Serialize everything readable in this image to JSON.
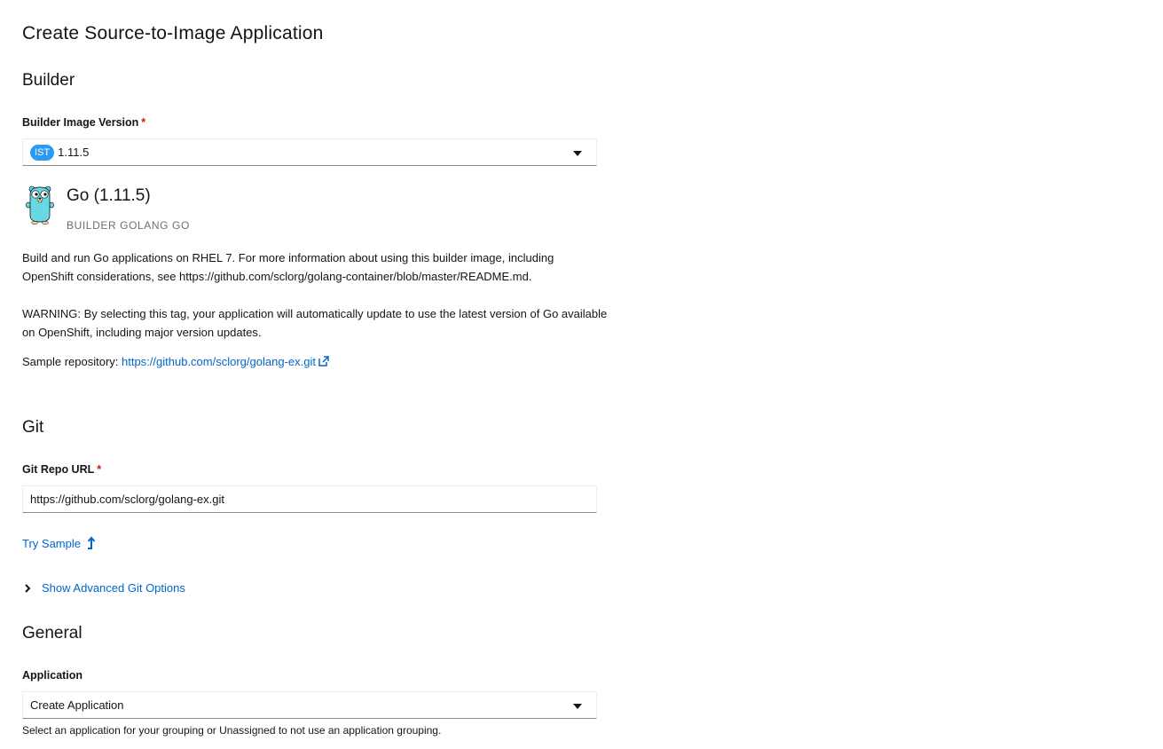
{
  "page": {
    "title": "Create Source-to-Image Application"
  },
  "builder": {
    "section_title": "Builder",
    "image_version_label": "Builder Image Version",
    "required_mark": "*",
    "selected_badge": "IST",
    "selected_version": "1.11.5",
    "name": "Go (1.11.5)",
    "tags": "BUILDER GOLANG GO",
    "description": "Build and run Go applications on RHEL 7. For more information about using this builder image, including OpenShift considerations, see https://github.com/sclorg/golang-container/blob/master/README.md.",
    "warning": "WARNING: By selecting this tag, your application will automatically update to use the latest version of Go available on OpenShift, including major version updates.",
    "sample_repo_label": "Sample repository: ",
    "sample_repo_url": "https://github.com/sclorg/golang-ex.git",
    "icon": "gopher-icon"
  },
  "git": {
    "section_title": "Git",
    "repo_url_label": "Git Repo URL",
    "required_mark": "*",
    "repo_url_value": "https://github.com/sclorg/golang-ex.git",
    "try_sample_label": "Try Sample",
    "advanced_options_label": "Show Advanced Git Options"
  },
  "general": {
    "section_title": "General",
    "application_label": "Application",
    "application_value": "Create Application",
    "application_helper": "Select an application for your grouping or Unassigned to not use an application grouping."
  },
  "colors": {
    "link": "#0066cc",
    "required": "#c9190b",
    "badge": "#2b9af3",
    "muted": "#6a6e73"
  }
}
